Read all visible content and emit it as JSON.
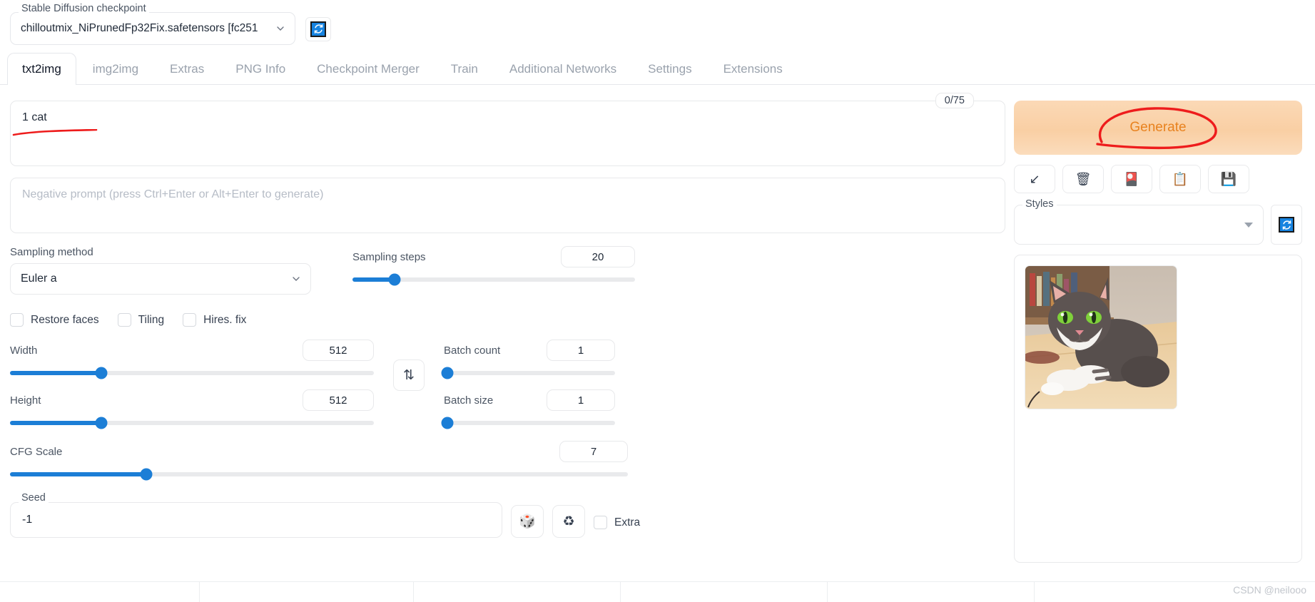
{
  "checkpoint": {
    "label": "Stable Diffusion checkpoint",
    "value": "chilloutmix_NiPrunedFp32Fix.safetensors [fc251",
    "refresh_icon": "refresh-icon"
  },
  "tabs": [
    {
      "label": "txt2img",
      "active": true
    },
    {
      "label": "img2img",
      "active": false
    },
    {
      "label": "Extras",
      "active": false
    },
    {
      "label": "PNG Info",
      "active": false
    },
    {
      "label": "Checkpoint Merger",
      "active": false
    },
    {
      "label": "Train",
      "active": false
    },
    {
      "label": "Additional Networks",
      "active": false
    },
    {
      "label": "Settings",
      "active": false
    },
    {
      "label": "Extensions",
      "active": false
    }
  ],
  "prompt": {
    "value": "1 cat",
    "token_counter": "0/75",
    "negative_placeholder": "Negative prompt (press Ctrl+Enter or Alt+Enter to generate)",
    "negative_value": ""
  },
  "generate": {
    "label": "Generate",
    "accent_color": "#e8821f",
    "annotation_color": "#ee1c1c"
  },
  "tools": [
    {
      "name": "send-to-arrow-icon",
      "glyph": "↙"
    },
    {
      "name": "trash-icon",
      "glyph": "🗑"
    },
    {
      "name": "paint-card-icon",
      "glyph": "🎴"
    },
    {
      "name": "clipboard-icon",
      "glyph": "📋"
    },
    {
      "name": "save-floppy-icon",
      "glyph": "💾"
    }
  ],
  "styles": {
    "label": "Styles",
    "value": "",
    "refresh_icon": "refresh-icon"
  },
  "sampling": {
    "method_label": "Sampling method",
    "method_value": "Euler a",
    "steps_label": "Sampling steps",
    "steps_value": "20",
    "steps_percent": 15
  },
  "toggles": [
    {
      "label": "Restore faces",
      "checked": false
    },
    {
      "label": "Tiling",
      "checked": false
    },
    {
      "label": "Hires. fix",
      "checked": false
    }
  ],
  "dimensions": {
    "width_label": "Width",
    "width_value": "512",
    "width_percent": 25,
    "height_label": "Height",
    "height_value": "512",
    "height_percent": 25,
    "swap_icon": "swap-arrows-icon",
    "swap_glyph": "⇅"
  },
  "batch": {
    "count_label": "Batch count",
    "count_value": "1",
    "count_percent": 0,
    "size_label": "Batch size",
    "size_value": "1",
    "size_percent": 0
  },
  "cfg": {
    "label": "CFG Scale",
    "value": "7",
    "percent": 22
  },
  "seed": {
    "label": "Seed",
    "value": "-1",
    "dice_icon": "dice-icon",
    "dice_glyph": "🎲",
    "recycle_icon": "recycle-icon",
    "recycle_glyph": "♻",
    "extra_label": "Extra",
    "extra_checked": false
  },
  "result": {
    "alt": "generated-cat-image"
  },
  "watermark": "CSDN @neilooo"
}
